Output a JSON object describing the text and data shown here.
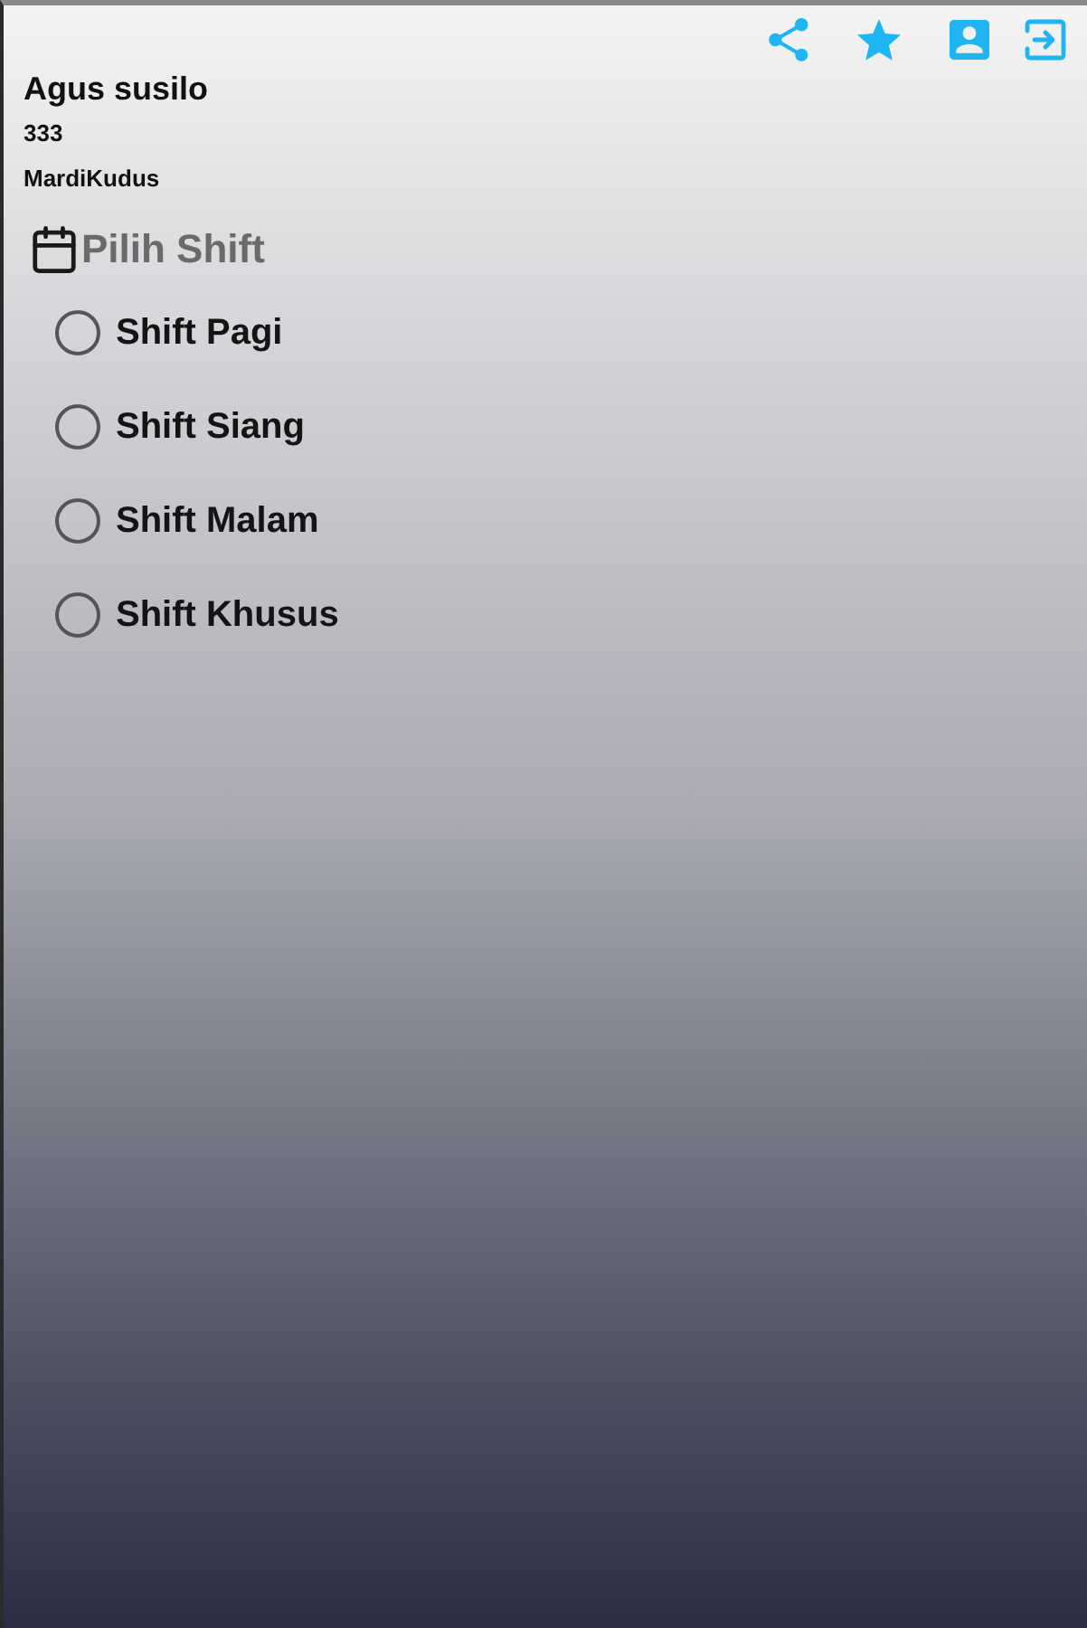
{
  "user": {
    "name": "Agus susilo",
    "id": "333",
    "location": "MardiKudus"
  },
  "section": {
    "title": "Pilih Shift"
  },
  "shifts": [
    {
      "label": "Shift Pagi",
      "selected": false
    },
    {
      "label": "Shift Siang",
      "selected": false
    },
    {
      "label": "Shift Malam",
      "selected": false
    },
    {
      "label": "Shift Khusus",
      "selected": false
    }
  ]
}
